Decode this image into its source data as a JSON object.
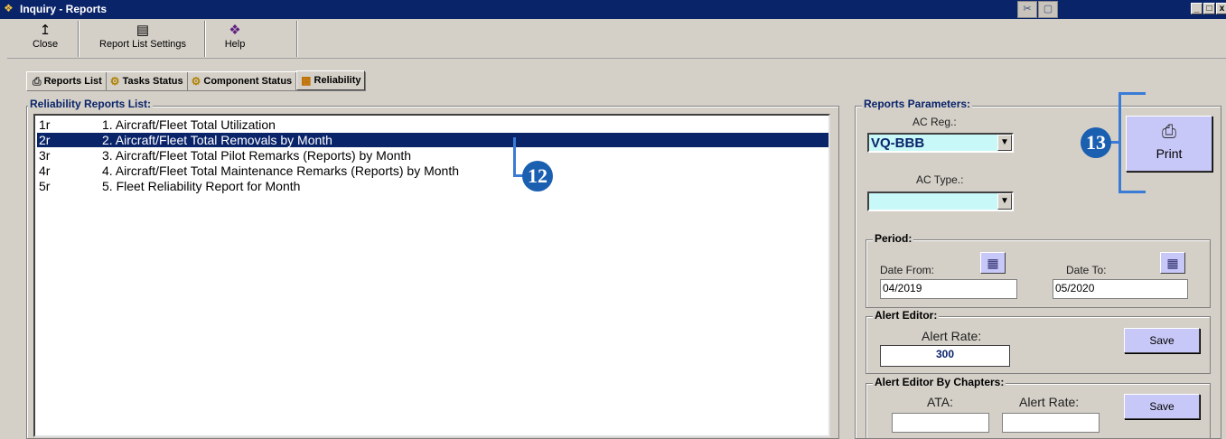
{
  "window": {
    "title": "Inquiry - Reports",
    "app_icon": "bolt-icon",
    "controls": [
      "_",
      "□",
      "x"
    ]
  },
  "toolbar": {
    "close_label": "Close",
    "close_icon": "door-exit-icon",
    "settings_label": "Report List Settings",
    "settings_icon": "list-settings-icon",
    "help_label": "Help",
    "help_icon": "help-book-icon"
  },
  "tabs": [
    {
      "label": "Reports List",
      "icon": "printer-icon"
    },
    {
      "label": "Tasks Status",
      "icon": "tasks-icon"
    },
    {
      "label": "Component Status",
      "icon": "component-icon"
    },
    {
      "label": "Reliability",
      "icon": "bar-chart-icon",
      "active": true
    }
  ],
  "reports": {
    "group_label": "Reliability Reports List:",
    "items": [
      {
        "code": "1r",
        "name": "1. Aircraft/Fleet Total Utilization"
      },
      {
        "code": "2r",
        "name": "2. Aircraft/Fleet Total Removals by Month"
      },
      {
        "code": "3r",
        "name": "3. Aircraft/Fleet Total Pilot Remarks (Reports) by Month"
      },
      {
        "code": "4r",
        "name": "4. Aircraft/Fleet Total Maintenance Remarks (Reports) by Month"
      },
      {
        "code": "5r",
        "name": "5. Fleet Reliability Report for Month"
      }
    ],
    "selected_index": 1
  },
  "params": {
    "group_label": "Reports Parameters:",
    "ac_reg_label": "AC Reg.:",
    "ac_reg_value": "VQ-BBB",
    "ac_type_label": "AC Type.:",
    "ac_type_value": "",
    "print_label": "Print"
  },
  "period": {
    "group_label": "Period:",
    "date_from_label": "Date From:",
    "date_from_value": "04/2019",
    "date_to_label": "Date To:",
    "date_to_value": "05/2020"
  },
  "alert_editor": {
    "group_label": "Alert Editor:",
    "rate_label": "Alert Rate:",
    "rate_value": "300",
    "save_label": "Save"
  },
  "alert_by_chapters": {
    "group_label": "Alert Editor By Chapters:",
    "ata_label": "ATA:",
    "ata_value": "",
    "rate_label": "Alert Rate:",
    "rate_value": "",
    "save_label": "Save"
  },
  "callouts": {
    "list": "12",
    "print": "13"
  },
  "colors": {
    "title_bar": "#0a246a",
    "selection": "#0a246a",
    "input_cyan": "#c8f8f8",
    "button_purple": "#c8c8f8",
    "callout_blue": "#1a5fb0"
  }
}
